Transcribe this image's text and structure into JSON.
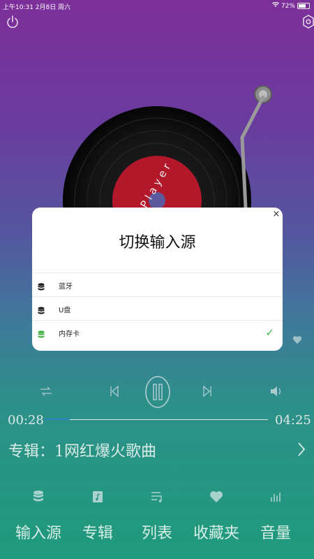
{
  "status_bar": {
    "left": "上午10:31   2月8日 周六",
    "battery": "72%"
  },
  "record": {
    "label_text": "i - P l a y e r"
  },
  "dialog": {
    "title": "切换输入源",
    "close": "×",
    "options": [
      {
        "label": "蓝牙",
        "icon": "database-icon",
        "selected": false
      },
      {
        "label": "U盘",
        "icon": "database-icon",
        "selected": false
      },
      {
        "label": "内存卡",
        "icon": "database-icon",
        "selected": true
      }
    ],
    "check": "✓"
  },
  "player": {
    "current_time": "00:28",
    "total_time": "04:25",
    "progress": 0.11
  },
  "album": {
    "text": "专辑：1网红爆火歌曲"
  },
  "tabs": [
    {
      "label": "输入源",
      "icon": "database-icon"
    },
    {
      "label": "专辑",
      "icon": "album-icon"
    },
    {
      "label": "列表",
      "icon": "playlist-icon"
    },
    {
      "label": "收藏夹",
      "icon": "heart-icon"
    },
    {
      "label": "音量",
      "icon": "equalizer-icon"
    }
  ],
  "colors": {
    "check": "#3dbb3d",
    "record_label": "#b3182a",
    "progress_fill": "#2f7fc0"
  }
}
